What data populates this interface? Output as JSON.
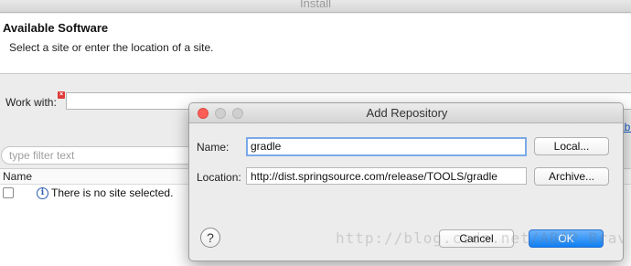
{
  "window": {
    "title": "Install"
  },
  "header": {
    "title": "Available Software",
    "description": "Select a site or enter the location of a site."
  },
  "work_with": {
    "label": "Work with:",
    "value": "",
    "link_fragment": "abl"
  },
  "filter": {
    "placeholder": "type filter text"
  },
  "table": {
    "column_name": "Name",
    "rows": [
      {
        "text": "There is no site selected.",
        "checked": false
      }
    ]
  },
  "dialog": {
    "title": "Add Repository",
    "name_label": "Name:",
    "name_value": "gradle",
    "location_label": "Location:",
    "location_value": "http://dist.springsource.com/release/TOOLS/gradle",
    "local_button": "Local...",
    "archive_button": "Archive...",
    "cancel_button": "Cancel",
    "ok_button": "OK",
    "help_glyph": "?"
  },
  "watermark": "http://blog.csdn.net/ABAP_Brave",
  "icons": {
    "error": "error-icon",
    "info": "info-icon",
    "help": "help-icon"
  },
  "colors": {
    "close_light": "#fc5f57",
    "primary_button": "#0f7ff3",
    "focus_ring": "#7aa9e8",
    "link": "#1a5fc7"
  }
}
